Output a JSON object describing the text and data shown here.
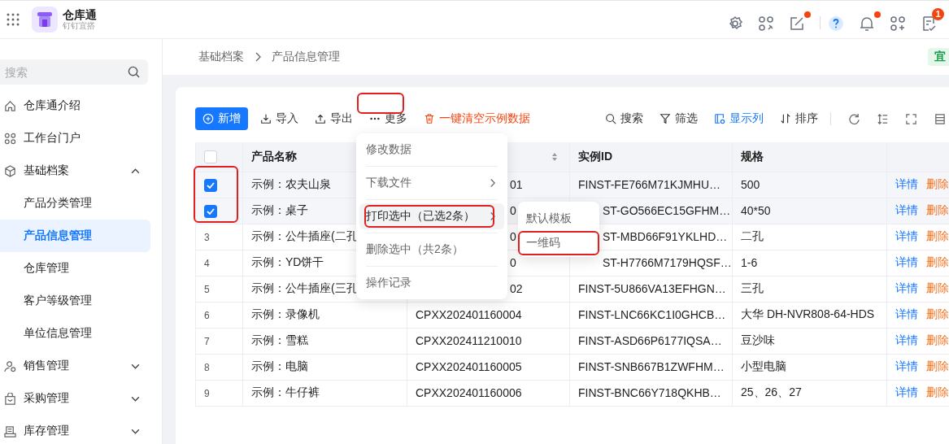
{
  "app": {
    "name": "仓库通",
    "subtitle": "钉钉宜搭"
  },
  "header_icons": [
    {
      "dot": false
    },
    {
      "dot": false
    },
    {
      "dot": true
    },
    {
      "dot": false
    },
    {
      "dot": true
    },
    {
      "dot": false
    },
    {
      "dot": false,
      "badge": "1"
    }
  ],
  "sidebar": {
    "search": {
      "placeholder": "搜索"
    },
    "items": [
      {
        "label": "仓库通介绍",
        "selected": false
      },
      {
        "label": "工作台门户",
        "selected": false
      },
      {
        "label": "基础档案",
        "selected": false,
        "expanded": true,
        "children": [
          {
            "label": "产品分类管理",
            "selected": false
          },
          {
            "label": "产品信息管理",
            "selected": true
          },
          {
            "label": "仓库管理",
            "selected": false
          },
          {
            "label": "客户等级管理",
            "selected": false
          },
          {
            "label": "单位信息管理",
            "selected": false
          }
        ]
      },
      {
        "label": "销售管理",
        "selected": false,
        "expanded": false
      },
      {
        "label": "采购管理",
        "selected": false,
        "expanded": false
      },
      {
        "label": "库存管理",
        "selected": false,
        "expanded": false
      }
    ]
  },
  "breadcrumb": [
    "基础档案",
    "产品信息管理"
  ],
  "corner_tag": "宜",
  "toolbar": {
    "left": [
      {
        "kind": "primary",
        "label": "新增",
        "highlight": false
      },
      {
        "kind": "plain",
        "label": "导入",
        "highlight": false
      },
      {
        "kind": "plain",
        "label": "导出",
        "highlight": false
      },
      {
        "kind": "plain",
        "label": "更多",
        "highlight": true
      },
      {
        "kind": "danger",
        "label": "一键清空示例数据",
        "highlight": false
      }
    ],
    "right": [
      {
        "label": "搜索",
        "active": false
      },
      {
        "label": "筛选",
        "active": false
      },
      {
        "label": "显示列",
        "active": true
      },
      {
        "label": "排序",
        "active": false
      }
    ]
  },
  "table": {
    "all_checked": false,
    "checkbox_highlight": true,
    "columns": [
      {
        "label": "产品名称",
        "sortable": false
      },
      {
        "sortable": true
      },
      {
        "label": "实例ID",
        "sortable": false
      },
      {
        "label": "规格",
        "sortable": false
      }
    ],
    "rows": [
      {
        "checked": true,
        "cells": [
          "示例：农夫山泉",
          {
            "text": "01",
            "clipped": true
          },
          "FINST-FE766M71KJMHU…",
          "500"
        ],
        "actions": [
          "详情",
          "删除"
        ]
      },
      {
        "checked": true,
        "cells": [
          "示例：桌子",
          {
            "text": "0",
            "clipped": true
          },
          {
            "text": "ST-GO566EC15GFHM…",
            "clipped": true
          },
          "40*50"
        ],
        "actions": [
          "详情",
          "删除"
        ]
      },
      {
        "checked": false,
        "index": "3",
        "cells": [
          "示例：公牛插座(二孔",
          {
            "text": "0",
            "clipped": true
          },
          {
            "text": "ST-MBD66F91YKLHD…",
            "clipped": true
          },
          "二孔"
        ],
        "actions": [
          "详情",
          "删除"
        ]
      },
      {
        "checked": false,
        "index": "4",
        "cells": [
          "示例：YD饼干",
          {
            "text": "0",
            "clipped": true
          },
          {
            "text": "ST-H7766M7179HQSF…",
            "clipped": true
          },
          "1-6"
        ],
        "actions": [
          "详情",
          "删除"
        ]
      },
      {
        "checked": false,
        "index": "5",
        "cells": [
          "示例：公牛插座(三孔",
          {
            "text": "02",
            "clipped": true
          },
          "FINST-5U866VA13EFHGN…",
          "三孔"
        ],
        "actions": [
          "详情",
          "删除"
        ]
      },
      {
        "checked": false,
        "index": "6",
        "cells": [
          "示例：录像机",
          "CPXX202401160004",
          "FINST-LNC66KC1I0GHCB…",
          "大华 DH-NVR808-64-HDS"
        ],
        "actions": [
          "详情",
          "删除"
        ]
      },
      {
        "checked": false,
        "index": "7",
        "cells": [
          "示例：雪糕",
          "CPXX202411210010",
          "FINST-ASD66P6177IQSA…",
          "豆沙味"
        ],
        "actions": [
          "详情",
          "删除"
        ]
      },
      {
        "checked": false,
        "index": "8",
        "cells": [
          "示例：电脑",
          "CPXX202401160005",
          "FINST-SNB667B1ZWFHM…",
          "小型电脑"
        ],
        "actions": [
          "详情",
          "删除"
        ]
      },
      {
        "checked": false,
        "index": "9",
        "cells": [
          "示例：牛仔裤",
          "CPXX202401160006",
          "FINST-BNC66Y718QKHB…",
          "25、26、27"
        ],
        "actions": [
          "详情",
          "删除"
        ]
      }
    ]
  },
  "menu": {
    "items": [
      {
        "label": "修改数据",
        "has_submenu": false,
        "highlighted": false,
        "highlight_box": false
      },
      {
        "label": "下载文件",
        "has_submenu": true,
        "highlighted": false,
        "highlight_box": false
      },
      {
        "label": "打印选中（已选2条）",
        "has_submenu": true,
        "highlighted": true,
        "highlight_box": true
      },
      {
        "label": "删除选中（共2条）",
        "has_submenu": false,
        "highlighted": false,
        "highlight_box": false
      },
      {
        "label": "操作记录",
        "has_submenu": false,
        "highlighted": false,
        "highlight_box": false
      }
    ]
  },
  "submenu": {
    "items": [
      {
        "label": "默认模板",
        "highlight_box": false
      },
      {
        "label": "一维码",
        "highlight_box": true
      }
    ]
  }
}
